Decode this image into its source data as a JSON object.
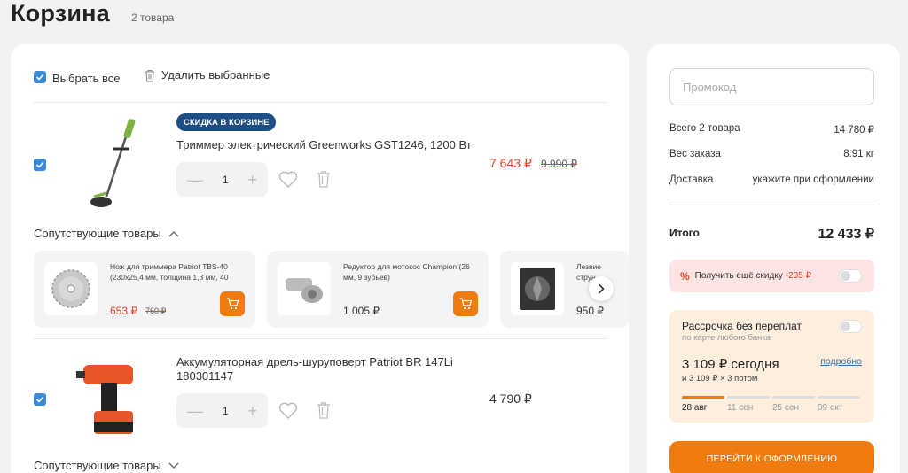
{
  "page": {
    "title": "Корзина",
    "count": "2 товара"
  },
  "toolbar": {
    "select_all": "Выбрать все",
    "delete_selected": "Удалить выбранные"
  },
  "items": [
    {
      "badge": "СКИДКА В КОРЗИНЕ",
      "name": "Триммер электрический Greenworks GST1246, 1200 Вт",
      "qty": "1",
      "price": "7 643 ₽",
      "old_price": "9 990 ₽",
      "related_title": "Сопутствующие товары",
      "related": [
        {
          "name": "Нож для триммера Patriot TBS-40 (230х25,4 мм, толщина 1,3 мм, 40",
          "price": "653 ₽",
          "old_price": "760 ₽",
          "sale": true
        },
        {
          "name": "Редуктор для мотокос Champion (26 мм, 9 зубьев)",
          "price": "1 005 ₽"
        },
        {
          "name": "Лезвие струн",
          "price": "950 ₽"
        }
      ]
    },
    {
      "name": "Аккумуляторная дрель-шуруповерт Patriot BR 147Li 180301147",
      "qty": "1",
      "price": "4 790 ₽",
      "related_title": "Сопутствующие товары"
    }
  ],
  "summary": {
    "promo_placeholder": "Промокод",
    "rows": [
      {
        "label": "Всего 2 товара",
        "value": "14 780 ₽"
      },
      {
        "label": "Вес заказа",
        "value": "8.91 кг"
      },
      {
        "label": "Доставка",
        "value": "укажите при оформлении"
      }
    ],
    "total_label": "Итого",
    "total_value": "12 433 ₽",
    "discount_text": "Получить ещё скидку",
    "discount_amount": "-235 ₽",
    "installment": {
      "title": "Рассрочка без переплат",
      "subtitle": "по карте любого банка",
      "amount": "3 109 ₽ сегодня",
      "more": "подробно",
      "rest": "и 3 109 ₽ × 3 потом",
      "dates": [
        "28 авг",
        "11 сен",
        "25 сен",
        "09 окт"
      ]
    },
    "checkout": "ПЕРЕЙТИ К ОФОРМЛЕНИЮ"
  },
  "colors": {
    "accent": "#f07c10",
    "sale": "#e8472a",
    "checkbox": "#3a8ad8",
    "badge": "#1f4e86"
  }
}
